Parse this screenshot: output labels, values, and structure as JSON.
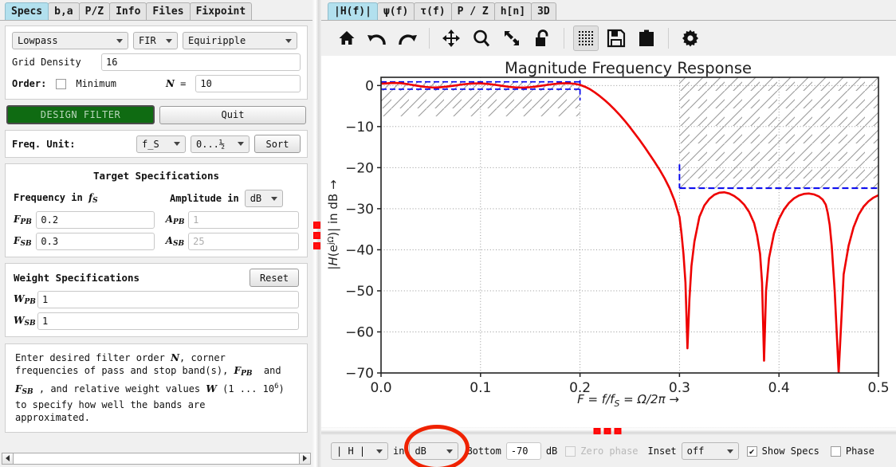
{
  "left": {
    "tabs": [
      {
        "label": "Specs",
        "active": true
      },
      {
        "label": "b,a",
        "active": false
      },
      {
        "label": "P/Z",
        "active": false
      },
      {
        "label": "Info",
        "active": false
      },
      {
        "label": "Files",
        "active": false
      },
      {
        "label": "Fixpoint",
        "active": false
      }
    ],
    "response_type": "Lowpass",
    "filter_class": "FIR",
    "design_method": "Equiripple",
    "grid_density_label": "Grid Density",
    "grid_density_value": "16",
    "order_label": "Order:",
    "order_minimum_label": "Minimum",
    "order_minimum_checked": false,
    "order_n_label": "N =",
    "order_n_value": "10",
    "design_filter_label": "DESIGN FILTER",
    "quit_label": "Quit",
    "freq_unit_label": "Freq. Unit:",
    "freq_unit_value": "f_S",
    "freq_range_value": "0...½",
    "sort_label": "Sort",
    "target_specs_title": "Target Specifications",
    "frequency_header": "Frequency in",
    "frequency_header_unit": "f",
    "frequency_header_unit_sub": "S",
    "amplitude_header": "Amplitude in",
    "amplitude_unit_value": "dB",
    "specs": [
      {
        "f_name": "F",
        "f_sub": "PB",
        "f_value": "0.2",
        "a_name": "A",
        "a_sub": "PB",
        "a_value": "1",
        "a_disabled": true
      },
      {
        "f_name": "F",
        "f_sub": "SB",
        "f_value": "0.3",
        "a_name": "A",
        "a_sub": "SB",
        "a_value": "25",
        "a_disabled": true
      }
    ],
    "weight_title": "Weight Specifications",
    "reset_label": "Reset",
    "weights": [
      {
        "name": "W",
        "sub": "PB",
        "value": "1"
      },
      {
        "name": "W",
        "sub": "SB",
        "value": "1"
      }
    ],
    "help_lines": [
      "Enter desired filter order N, corner",
      "frequencies of pass and stop band(s), F_PB and",
      "F_SB , and relative weight values W (1 ... 10⁶)",
      "to specify how well the bands are",
      "approximated."
    ]
  },
  "right": {
    "tabs": [
      {
        "label": "|H(f)|",
        "active": true
      },
      {
        "label": "ψ(f)",
        "active": false
      },
      {
        "label": "τ(f)",
        "active": false
      },
      {
        "label": "P / Z",
        "active": false
      },
      {
        "label": "h[n]",
        "active": false
      },
      {
        "label": "3D",
        "active": false
      }
    ],
    "toolbar": [
      {
        "name": "home-icon",
        "tip": "Home",
        "active": false
      },
      {
        "name": "undo-icon",
        "tip": "Back",
        "active": false
      },
      {
        "name": "redo-icon",
        "tip": "Forward",
        "active": false
      },
      {
        "name": "move-icon",
        "tip": "Pan",
        "active": false
      },
      {
        "name": "zoom-icon",
        "tip": "Zoom",
        "active": false
      },
      {
        "name": "resize-icon",
        "tip": "Configure subplots",
        "active": false
      },
      {
        "name": "unlock-icon",
        "tip": "Lock",
        "active": false
      },
      {
        "name": "grid-icon",
        "tip": "Grid",
        "active": true
      },
      {
        "name": "save-icon",
        "tip": "Save",
        "active": false
      },
      {
        "name": "clipboard-icon",
        "tip": "Copy to clipboard",
        "active": false
      },
      {
        "name": "gear-icon",
        "tip": "Settings",
        "active": false
      }
    ],
    "bottom": {
      "h_select_value": "| H |",
      "in_label": "in",
      "unit_value": "dB",
      "bottom_label": "Bottom",
      "bottom_value": "-70",
      "db_label": "dB",
      "zero_phase_label": "Zero phase",
      "zero_phase_checked": false,
      "zero_phase_disabled": true,
      "inset_label": "Inset",
      "inset_value": "off",
      "show_specs_label": "Show Specs",
      "show_specs_checked": true,
      "phase_label": "Phase",
      "phase_checked": false
    },
    "highlight_color": "#ef2200"
  },
  "chart_data": {
    "type": "line",
    "title": "Magnitude Frequency Response",
    "xlabel": "F = f/f_S = Ω/2π →",
    "ylabel": "|H(e^{jΩ})| in dB →",
    "xlim": [
      0.0,
      0.5
    ],
    "ylim": [
      -70,
      2
    ],
    "xticks": [
      0.0,
      0.1,
      0.2,
      0.3,
      0.4,
      0.5
    ],
    "xticklabels": [
      "0.0",
      "0.1",
      "0.2",
      "0.3",
      "0.4",
      "0.5"
    ],
    "yticks": [
      0,
      -10,
      -20,
      -30,
      -40,
      -50,
      -60,
      -70
    ],
    "yticklabels": [
      "0",
      "−10",
      "−20",
      "−30",
      "−40",
      "−50",
      "−60",
      "−70"
    ],
    "grid": true,
    "legend": "none",
    "curve_color": "#ee0000",
    "spec_color": "#0000ee",
    "hatch_color": "#999999",
    "spec_regions": [
      {
        "name": "passband",
        "x0": 0.0,
        "x1": 0.2,
        "upper_db": 0.9,
        "lower_db": -0.9,
        "hatch_above": true
      },
      {
        "name": "stopband",
        "x0": 0.3,
        "x1": 0.5,
        "upper_db": 2.0,
        "lower_db": -25.0,
        "hatch_above": true
      }
    ],
    "series": [
      {
        "name": "|H(e^{jΩ})|",
        "x": [
          0.0,
          0.005,
          0.01,
          0.015,
          0.02,
          0.025,
          0.03,
          0.035,
          0.04,
          0.045,
          0.05,
          0.055,
          0.06,
          0.065,
          0.07,
          0.075,
          0.08,
          0.085,
          0.09,
          0.095,
          0.1,
          0.105,
          0.11,
          0.115,
          0.12,
          0.125,
          0.13,
          0.135,
          0.14,
          0.145,
          0.15,
          0.155,
          0.16,
          0.165,
          0.17,
          0.175,
          0.18,
          0.185,
          0.19,
          0.195,
          0.2,
          0.205,
          0.21,
          0.215,
          0.22,
          0.225,
          0.23,
          0.235,
          0.24,
          0.245,
          0.25,
          0.255,
          0.26,
          0.265,
          0.27,
          0.275,
          0.28,
          0.285,
          0.29,
          0.295,
          0.3,
          0.302,
          0.304,
          0.306,
          0.308,
          0.31,
          0.312,
          0.315,
          0.32,
          0.325,
          0.33,
          0.335,
          0.34,
          0.345,
          0.35,
          0.355,
          0.36,
          0.365,
          0.37,
          0.375,
          0.378,
          0.381,
          0.383,
          0.385,
          0.387,
          0.39,
          0.395,
          0.4,
          0.405,
          0.41,
          0.415,
          0.42,
          0.425,
          0.43,
          0.435,
          0.44,
          0.444,
          0.447,
          0.449,
          0.451,
          0.453,
          0.456,
          0.46,
          0.465,
          0.47,
          0.475,
          0.48,
          0.485,
          0.49,
          0.495,
          0.5
        ],
        "y": [
          0.45,
          0.5,
          0.6,
          0.62,
          0.55,
          0.4,
          0.2,
          0.0,
          -0.2,
          -0.35,
          -0.45,
          -0.48,
          -0.42,
          -0.3,
          -0.15,
          0.02,
          0.2,
          0.35,
          0.45,
          0.5,
          0.5,
          0.44,
          0.32,
          0.16,
          -0.02,
          -0.2,
          -0.35,
          -0.45,
          -0.5,
          -0.48,
          -0.4,
          -0.26,
          -0.1,
          0.08,
          0.25,
          0.4,
          0.5,
          0.55,
          0.52,
          0.4,
          0.15,
          -0.3,
          -0.9,
          -1.7,
          -2.6,
          -3.6,
          -4.7,
          -5.9,
          -7.2,
          -8.6,
          -10.1,
          -11.7,
          -13.3,
          -15.0,
          -16.8,
          -18.6,
          -20.5,
          -22.6,
          -25.0,
          -28.0,
          -32.0,
          -36.0,
          -41.0,
          -48.0,
          -64.0,
          -52.0,
          -44.0,
          -38.0,
          -32.0,
          -29.2,
          -27.6,
          -26.6,
          -26.1,
          -26.0,
          -26.3,
          -26.9,
          -27.8,
          -29.0,
          -30.8,
          -33.5,
          -36.5,
          -41.0,
          -48.0,
          -67.0,
          -50.0,
          -42.0,
          -36.0,
          -32.5,
          -30.2,
          -28.6,
          -27.5,
          -26.8,
          -26.4,
          -26.3,
          -26.5,
          -27.0,
          -27.8,
          -29.0,
          -31.0,
          -34.0,
          -39.0,
          -50.0,
          -70.0,
          -46.0,
          -39.0,
          -34.5,
          -31.5,
          -29.5,
          -28.2,
          -27.3,
          -26.7,
          -26.4,
          -26.3
        ]
      }
    ]
  }
}
